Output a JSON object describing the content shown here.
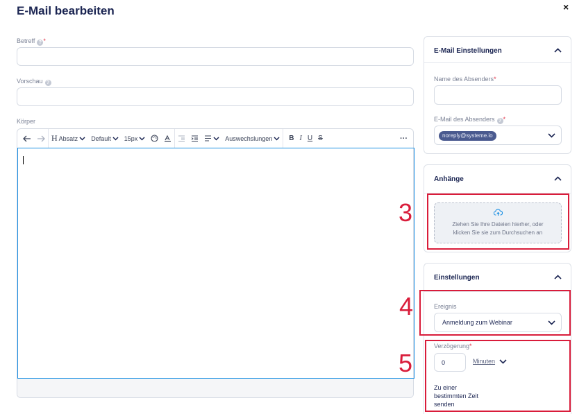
{
  "dialog": {
    "title": "E-Mail bearbeiten",
    "close_glyph": "×"
  },
  "form": {
    "subject_label": "Betreff",
    "subject_value": "",
    "preview_label": "Vorschau",
    "preview_value": "",
    "body_label": "Körper",
    "required_mark": "*",
    "help_glyph": "?"
  },
  "toolbar": {
    "heading_label": "Absatz",
    "font_label": "Default",
    "size_label": "15px",
    "substitutions_label": "Auswechslungen",
    "more_label": "···"
  },
  "email_settings": {
    "header": "E-Mail Einstellungen",
    "sender_name_label": "Name des Absenders",
    "sender_name_value": "",
    "sender_email_label": "E-Mail des Absenders",
    "sender_email_value": "noreply@systeme.io"
  },
  "attachments": {
    "header": "Anhänge",
    "dropzone_text_line1": "Ziehen Sie Ihre Dateien hierher, oder",
    "dropzone_text_line2": "klicken Sie sie zum Durchsuchen an"
  },
  "settings": {
    "header": "Einstellungen",
    "event_label": "Ereignis",
    "event_value": "Anmeldung zum Webinar",
    "delay_label": "Verzögerung",
    "delay_value": "0",
    "delay_unit": "Minuten",
    "specific_time_line1": "Zu einer",
    "specific_time_line2": "bestimmten Zeit",
    "specific_time_line3": "senden"
  },
  "annotations": {
    "a3": "3",
    "a4": "4",
    "a5": "5",
    "color": "#d91c3a"
  },
  "colors": {
    "accent": "#1a8fe3",
    "title": "#1b2552"
  }
}
